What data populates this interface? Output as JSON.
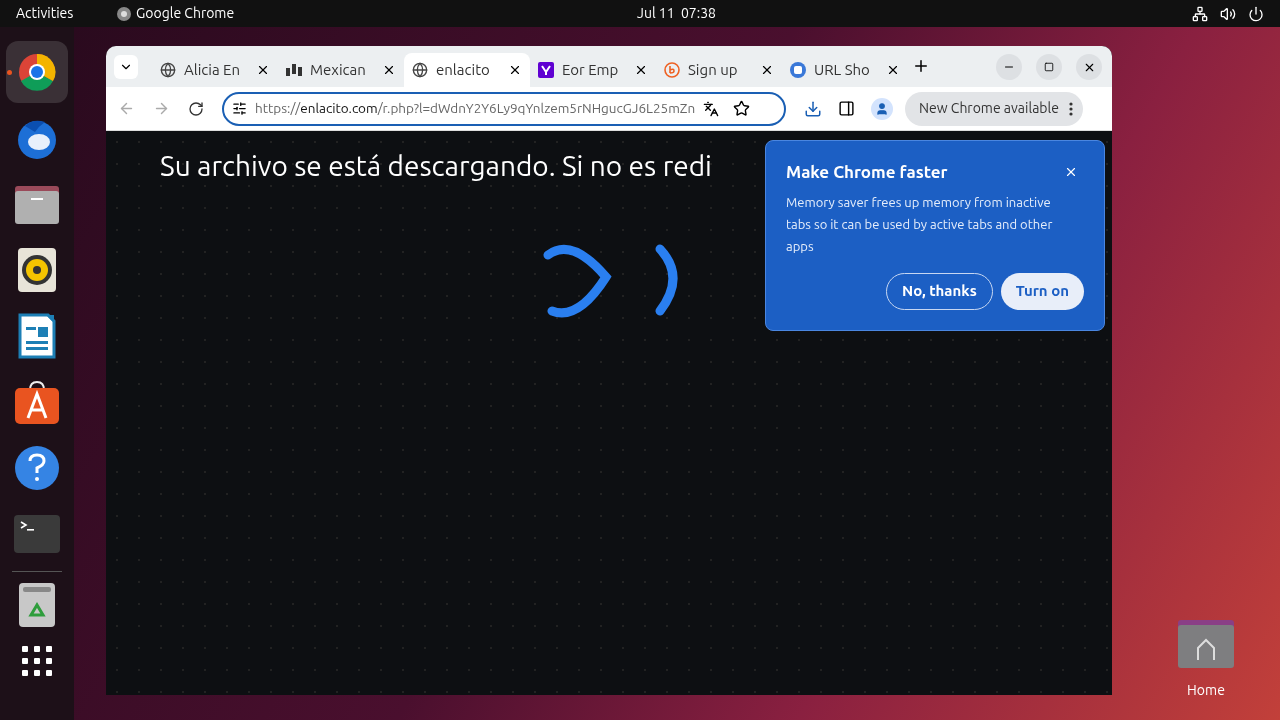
{
  "top_bar": {
    "activities": "Activities",
    "app_name": "Google Chrome",
    "clock": "Jul 11  07:38"
  },
  "dock": {
    "items": [
      {
        "kind": "chrome",
        "running": true
      },
      {
        "kind": "mail",
        "running": false
      },
      {
        "kind": "files",
        "running": false
      },
      {
        "kind": "music",
        "running": false
      },
      {
        "kind": "writer",
        "running": false
      },
      {
        "kind": "store",
        "running": false
      },
      {
        "kind": "help",
        "running": false
      },
      {
        "kind": "terminal",
        "running": false
      },
      {
        "kind": "trash",
        "running": false
      }
    ]
  },
  "tabs": [
    {
      "title": "Alicia En",
      "kind": "globe",
      "selected": false
    },
    {
      "title": "Mexican",
      "kind": "bars",
      "selected": false
    },
    {
      "title": "enlacito",
      "kind": "globe",
      "selected": true
    },
    {
      "title": "Eor Emp",
      "kind": "yahoo",
      "selected": false
    },
    {
      "title": "Sign up",
      "kind": "bitly",
      "selected": false
    },
    {
      "title": "URL Sho",
      "kind": "square",
      "selected": false
    }
  ],
  "address": {
    "scheme": "https://",
    "host": "enlacito.com",
    "path": "/r.php?l=dWdnY2Y6Ly9qYnlzem5rNHgucGJ6L25mZn"
  },
  "update_button": "New Chrome available",
  "page": {
    "message": "Su archivo se está descargando. Si no es redi"
  },
  "popup": {
    "title": "Make Chrome faster",
    "body": "Memory saver frees up memory from inactive tabs so it can be used by active tabs and other apps",
    "buttons": [
      {
        "label": "No, thanks",
        "kind": "outline"
      },
      {
        "label": "Turn on",
        "kind": "filled"
      }
    ]
  },
  "desktop_icon": {
    "label": "Home"
  }
}
